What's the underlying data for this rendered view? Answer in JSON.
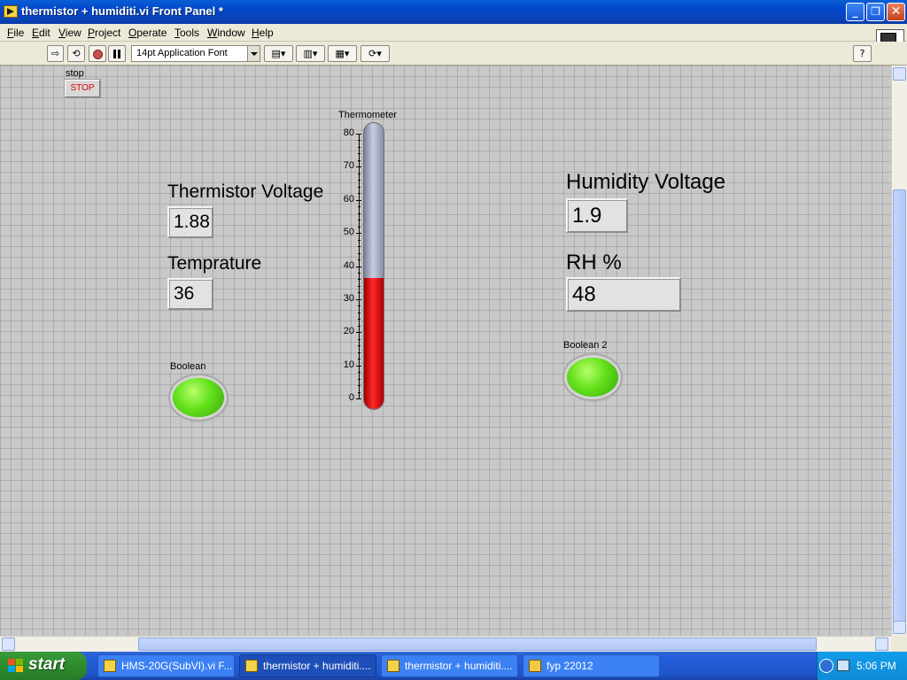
{
  "window": {
    "title": "thermistor + humiditi.vi Front Panel *",
    "min": "_",
    "restore": "❐",
    "close": "✕"
  },
  "menu": [
    "File",
    "Edit",
    "View",
    "Project",
    "Operate",
    "Tools",
    "Window",
    "Help"
  ],
  "toolbar": {
    "font": "14pt Application Font",
    "help": "?",
    "vi_icon_number": "1"
  },
  "panel": {
    "stop": {
      "label": "stop",
      "button": "STOP"
    },
    "thermometer": {
      "label": "Thermometer",
      "ticks": [
        "80",
        "70",
        "60",
        "50",
        "40",
        "30",
        "20",
        "10",
        "0"
      ],
      "min": 0,
      "max": 80,
      "value": 36,
      "accent": "#e00000"
    },
    "thermistor_voltage": {
      "label": "Thermistor Voltage",
      "value": "1.88"
    },
    "temperature": {
      "label": "Temprature",
      "value": "36"
    },
    "boolean1": {
      "label": "Boolean",
      "color": "#62e01a"
    },
    "humidity_voltage": {
      "label": "Humidity Voltage",
      "value": "1.9"
    },
    "rh": {
      "label": "RH %",
      "value": "48"
    },
    "boolean2": {
      "label": "Boolean 2",
      "color": "#62e01a"
    }
  },
  "taskbar": {
    "start": "start",
    "tasks": [
      {
        "label": "HMS-20G(SubVI).vi F...",
        "icon": "labview-icon",
        "active": false
      },
      {
        "label": "thermistor + humiditi....",
        "icon": "labview-icon",
        "active": true
      },
      {
        "label": "thermistor + humiditi....",
        "icon": "labview-icon",
        "active": false
      },
      {
        "label": "fyp 22012",
        "icon": "folder-icon",
        "active": false
      }
    ],
    "clock": "5:06 PM"
  }
}
